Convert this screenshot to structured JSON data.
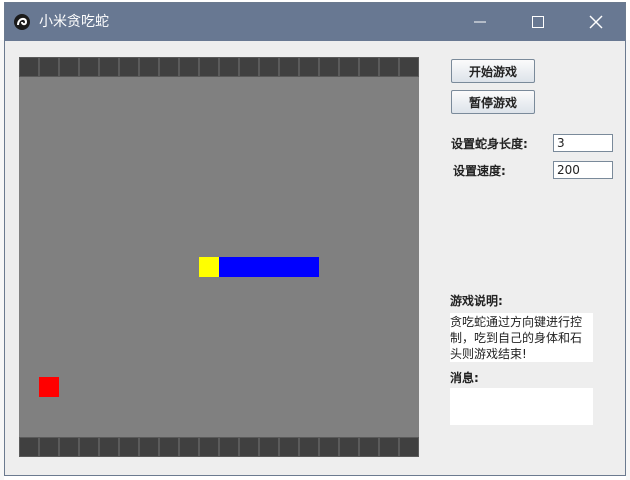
{
  "window": {
    "title": "小米贪吃蛇"
  },
  "game": {
    "board_cells": 20,
    "snake": [
      {
        "col": 9,
        "row": 10,
        "kind": "head"
      },
      {
        "col": 10,
        "row": 10,
        "kind": "body"
      },
      {
        "col": 11,
        "row": 10,
        "kind": "body"
      },
      {
        "col": 12,
        "row": 10,
        "kind": "body"
      },
      {
        "col": 13,
        "row": 10,
        "kind": "body"
      },
      {
        "col": 14,
        "row": 10,
        "kind": "body"
      }
    ],
    "food": {
      "col": 1,
      "row": 16
    },
    "colors": {
      "board": "#808080",
      "wall": "#404040",
      "head": "#ffff00",
      "body": "#0000ff",
      "food": "#ff0000"
    }
  },
  "controls": {
    "start_label": "开始游戏",
    "pause_label": "暂停游戏",
    "length_label": "设置蛇身长度:",
    "length_value": "3",
    "speed_label": "设置速度:",
    "speed_value": "200"
  },
  "info": {
    "instructions_label": "游戏说明:",
    "instructions_text": "贪吃蛇通过方向键进行控制，吃到自己的身体和石头则游戏结束!",
    "message_label": "消息:",
    "message_text": ""
  }
}
